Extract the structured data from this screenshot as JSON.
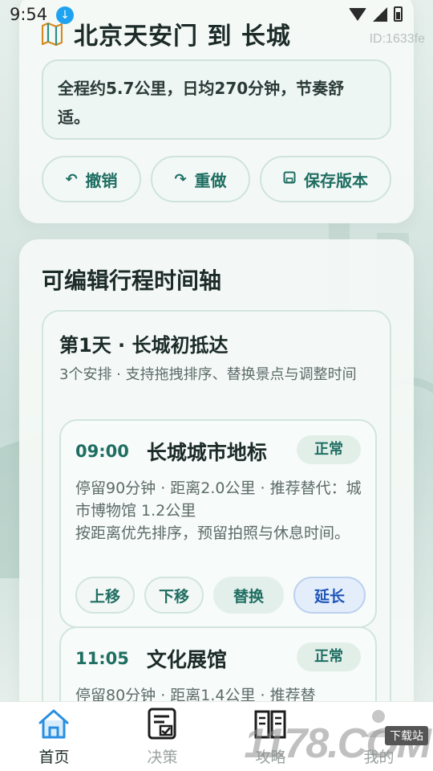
{
  "status_bar": {
    "time": "9:54"
  },
  "watermark_id": "ID:1633fe",
  "route": {
    "title": "北京天安门 到 长城",
    "summary": "全程约5.7公里，日均270分钟，节奏舒适。",
    "actions": {
      "undo": "撤销",
      "redo": "重做",
      "save": "保存版本"
    }
  },
  "timeline": {
    "section_title": "可编辑行程时间轴",
    "day": {
      "title": "第1天 · 长城初抵达",
      "desc": "3个安排 · 支持拖拽排序、替换景点与调整时间",
      "stops": [
        {
          "time": "09:00",
          "name": "长城城市地标",
          "status": "正常",
          "detail_line1": "停留90分钟 · 距离2.0公里 · 推荐替代：城市博物馆 1.2公里",
          "detail_line2": "按距离优先排序，预留拍照与休息时间。",
          "actions": {
            "up": "上移",
            "down": "下移",
            "swap": "替换",
            "extend": "延长"
          }
        },
        {
          "time": "11:05",
          "name": "文化展馆",
          "status": "正常",
          "detail_line1": "停留80分钟 · 距离1.4公里 · 推荐替"
        }
      ]
    }
  },
  "bottom_nav": [
    {
      "label": "首页",
      "icon": "home-icon",
      "active": true
    },
    {
      "label": "决策",
      "icon": "checklist-icon",
      "active": false
    },
    {
      "label": "攻略",
      "icon": "book-icon",
      "active": false
    },
    {
      "label": "我的",
      "icon": "profile-icon",
      "active": false
    }
  ],
  "brand": {
    "mark": "1178.COM",
    "tag": "下载站"
  },
  "colors": {
    "accent": "#1f6e62",
    "extend": "#1e55b8",
    "home_icon": "#2a8fe0"
  }
}
